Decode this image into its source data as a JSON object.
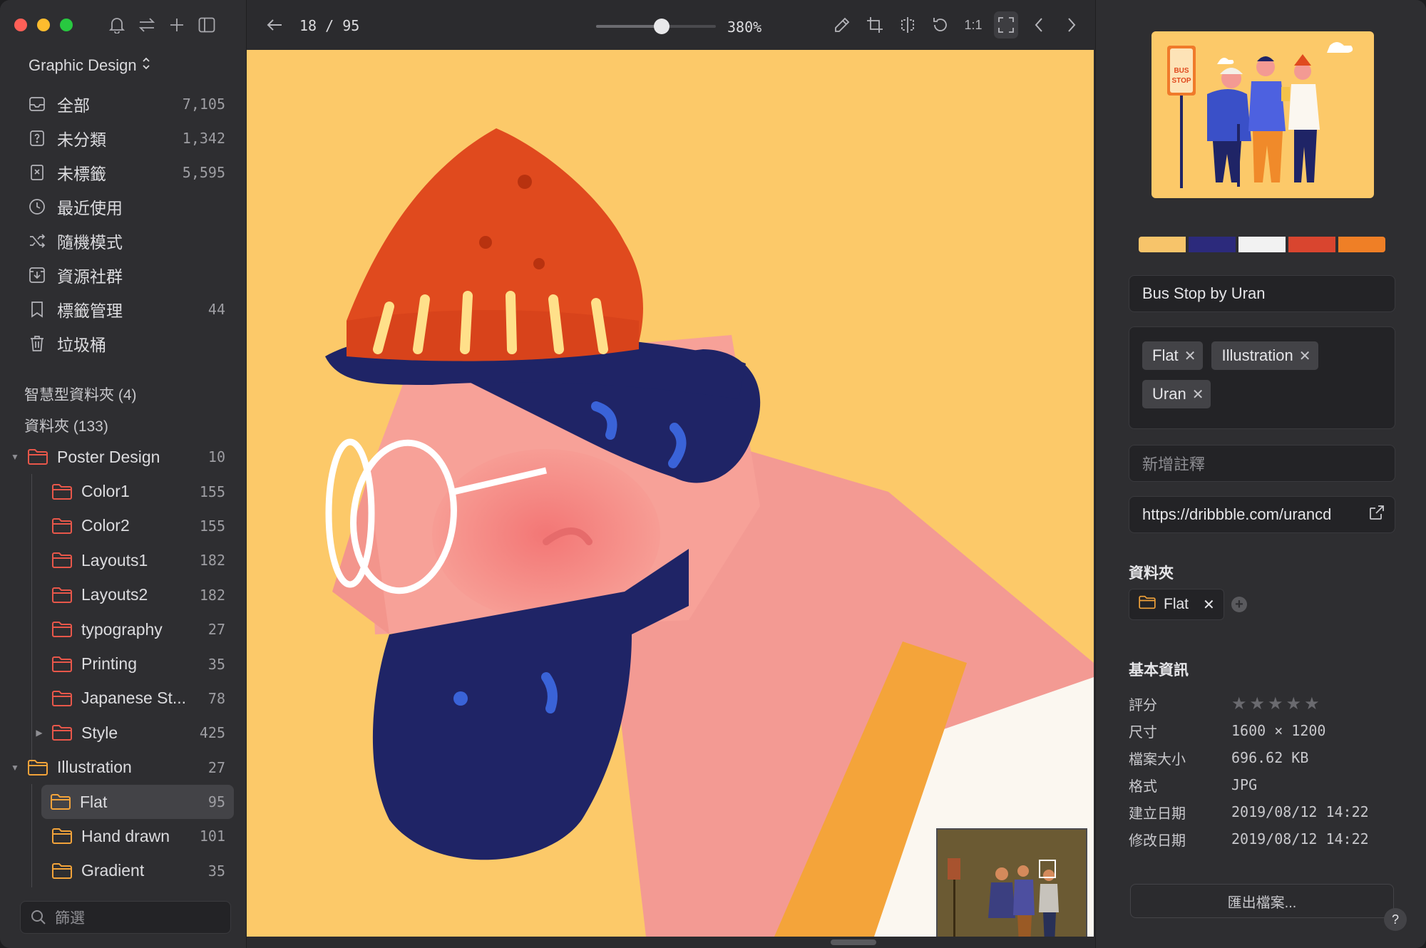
{
  "sidebar": {
    "library_title": "Graphic Design",
    "toolbar_icons": [
      "bell-icon",
      "swap-icon",
      "plus-icon",
      "sidebar-toggle-icon"
    ],
    "nav": [
      {
        "label": "全部",
        "count": "7,105",
        "icon": "inbox-icon"
      },
      {
        "label": "未分類",
        "count": "1,342",
        "icon": "question-box-icon"
      },
      {
        "label": "未標籤",
        "count": "5,595",
        "icon": "untagged-icon"
      },
      {
        "label": "最近使用",
        "count": "",
        "icon": "clock-icon"
      },
      {
        "label": "隨機模式",
        "count": "",
        "icon": "shuffle-icon"
      },
      {
        "label": "資源社群",
        "count": "",
        "icon": "download-box-icon"
      },
      {
        "label": "標籤管理",
        "count": "44",
        "icon": "bookmark-icon"
      },
      {
        "label": "垃圾桶",
        "count": "",
        "icon": "trash-icon"
      }
    ],
    "smart_folders": "智慧型資料夾 (4)",
    "folders_heading": "資料夾 (133)",
    "tree": [
      {
        "label": "Poster Design",
        "count": "10",
        "level": 0,
        "expanded": true
      },
      {
        "label": "Color1",
        "count": "155",
        "level": 1
      },
      {
        "label": "Color2",
        "count": "155",
        "level": 1
      },
      {
        "label": "Layouts1",
        "count": "182",
        "level": 1
      },
      {
        "label": "Layouts2",
        "count": "182",
        "level": 1
      },
      {
        "label": "typography",
        "count": "27",
        "level": 1
      },
      {
        "label": "Printing",
        "count": "35",
        "level": 1
      },
      {
        "label": "Japanese St...",
        "count": "78",
        "level": 1
      },
      {
        "label": "Style",
        "count": "425",
        "level": 1,
        "collapsed": true
      },
      {
        "label": "Illustration",
        "count": "27",
        "level": 0,
        "expanded": true
      },
      {
        "label": "Flat",
        "count": "95",
        "level": 1,
        "selected": true
      },
      {
        "label": "Hand drawn",
        "count": "101",
        "level": 1
      },
      {
        "label": "Gradient",
        "count": "35",
        "level": 1
      }
    ],
    "filter_placeholder": "篩選"
  },
  "viewer": {
    "page_current": "18",
    "page_separator": "/",
    "page_total": "95",
    "zoom_label": "380%",
    "zoom_slider_fraction": 0.55,
    "ratio_label": "1:1",
    "tools": [
      "pencil-icon",
      "crop-icon",
      "flip-icon",
      "rotate-icon",
      "one-to-one",
      "fullscreen-icon",
      "prev-icon",
      "next-icon"
    ]
  },
  "inspector": {
    "palette": [
      "#f7c46a",
      "#2c2a7c",
      "#f2f2f2",
      "#d9452f",
      "#ef7f26"
    ],
    "title": "Bus Stop by Uran",
    "thumbnail_sign": [
      "BUS",
      "STOP"
    ],
    "tags": [
      "Flat",
      "Illustration",
      "Uran"
    ],
    "annotation_placeholder": "新增註釋",
    "url": "https://dribbble.com/urancd",
    "folders_heading": "資料夾",
    "folder_chip": "Flat",
    "basic_info_heading": "基本資訊",
    "info": [
      {
        "key": "評分",
        "value": ""
      },
      {
        "key": "尺寸",
        "value": "1600 × 1200"
      },
      {
        "key": "檔案大小",
        "value": "696.62 KB"
      },
      {
        "key": "格式",
        "value": "JPG"
      },
      {
        "key": "建立日期",
        "value": "2019/08/12 14:22"
      },
      {
        "key": "修改日期",
        "value": "2019/08/12 14:22"
      }
    ],
    "rating": 0,
    "rating_max": 5,
    "export_label": "匯出檔案...",
    "help_label": "?"
  }
}
